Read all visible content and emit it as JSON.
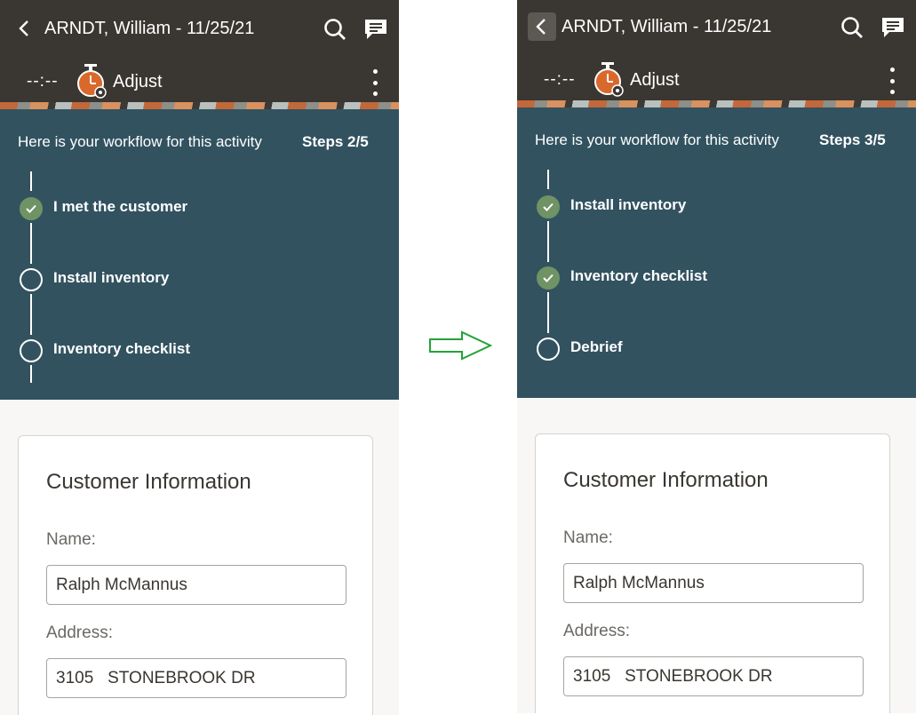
{
  "arrow_color": "#23a33a",
  "screens": {
    "left": {
      "header": {
        "title": "ARNDT, William - 11/25/21",
        "timer": "--:--",
        "adjust_label": "Adjust"
      },
      "workflow": {
        "intro": "Here is your workflow for this activity",
        "steps_label": "Steps 2/5",
        "items": [
          {
            "label": "I met the customer",
            "completed": true
          },
          {
            "label": "Install inventory",
            "completed": false
          },
          {
            "label": "Inventory checklist",
            "completed": false
          }
        ]
      },
      "customer_card": {
        "title": "Customer Information",
        "name_label": "Name:",
        "name_value": "Ralph McMannus",
        "address_label": "Address:",
        "address_value": "3105   STONEBROOK DR"
      }
    },
    "right": {
      "header": {
        "title": "ARNDT, William - 11/25/21",
        "timer": "--:--",
        "adjust_label": "Adjust"
      },
      "workflow": {
        "intro": "Here is your workflow for this activity",
        "steps_label": "Steps 3/5",
        "items": [
          {
            "label": "Install inventory",
            "completed": true
          },
          {
            "label": "Inventory checklist",
            "completed": true
          },
          {
            "label": "Debrief",
            "completed": false
          }
        ]
      },
      "customer_card": {
        "title": "Customer Information",
        "name_label": "Name:",
        "name_value": "Ralph McMannus",
        "address_label": "Address:",
        "address_value": "3105   STONEBROOK DR"
      }
    }
  }
}
